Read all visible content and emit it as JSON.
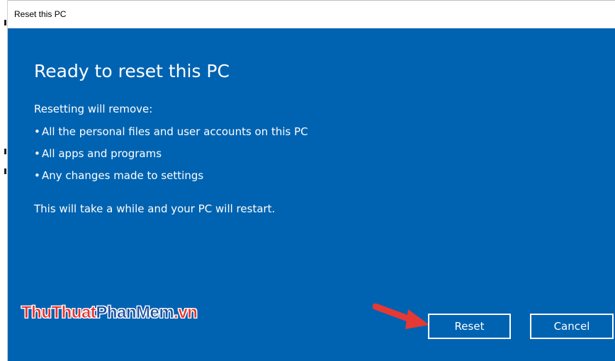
{
  "window": {
    "title": "Reset this PC"
  },
  "content": {
    "heading": "Ready to reset this PC",
    "intro": "Resetting will remove:",
    "bullet_char": "•",
    "items": [
      "All the personal files and user accounts on this PC",
      "All apps and programs",
      "Any changes made to settings"
    ],
    "note": "This will take a while and your PC will restart."
  },
  "buttons": {
    "reset_label": "Reset",
    "cancel_label": "Cancel"
  },
  "watermark": {
    "part1": "ThuThuat",
    "part2": "PhanMem",
    "part3": ".vn"
  },
  "colors": {
    "background": "#0063b1",
    "text": "#ffffff",
    "arrow": "#e53935"
  },
  "icons": {
    "annotation_arrow": "red-arrow-icon"
  }
}
